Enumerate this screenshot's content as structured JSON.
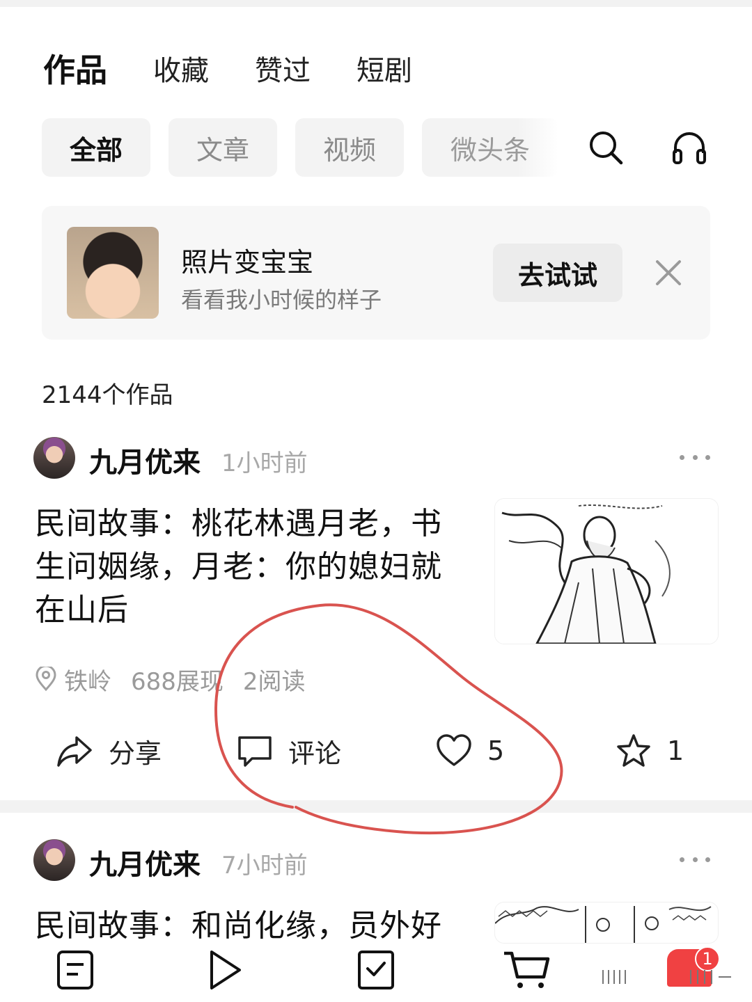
{
  "main_tabs": [
    {
      "label": "作品",
      "active": true
    },
    {
      "label": "收藏",
      "active": false
    },
    {
      "label": "赞过",
      "active": false
    },
    {
      "label": "短剧",
      "active": false
    }
  ],
  "filter_chips": [
    {
      "label": "全部",
      "active": true
    },
    {
      "label": "文章",
      "active": false
    },
    {
      "label": "视频",
      "active": false
    },
    {
      "label": "微头条",
      "active": false
    }
  ],
  "toolbar_icons": [
    "search-icon",
    "headphones-icon"
  ],
  "banner": {
    "title": "照片变宝宝",
    "subtitle": "看看我小时候的样子",
    "button": "去试试",
    "close_icon": "close-icon"
  },
  "works_count": "2144个作品",
  "posts": [
    {
      "author": "九月优来",
      "time": "1小时前",
      "title_lines": [
        "民间故事：桃花林遇月老，书",
        "生问姻缘，月老：你的媳妇就",
        "在山后"
      ],
      "location": "铁岭",
      "impressions": "688展现",
      "reads": "2阅读",
      "actions": {
        "share": "分享",
        "comment": "评论",
        "like_count": "5",
        "favorite_count": "1"
      }
    },
    {
      "author": "九月优来",
      "time": "7小时前",
      "title_lines": [
        "民间故事：和尚化缘，员外好"
      ]
    }
  ],
  "bottom_nav": {
    "badge_count": "1",
    "icons": [
      "home-doc-icon",
      "video-play-icon",
      "task-check-icon",
      "cart-icon",
      "profile-icon"
    ]
  },
  "colors": {
    "accent_red": "#f04142",
    "annotation_red": "#d9534f",
    "chip_bg": "#f3f3f3",
    "muted_text": "#9a9a9a"
  }
}
